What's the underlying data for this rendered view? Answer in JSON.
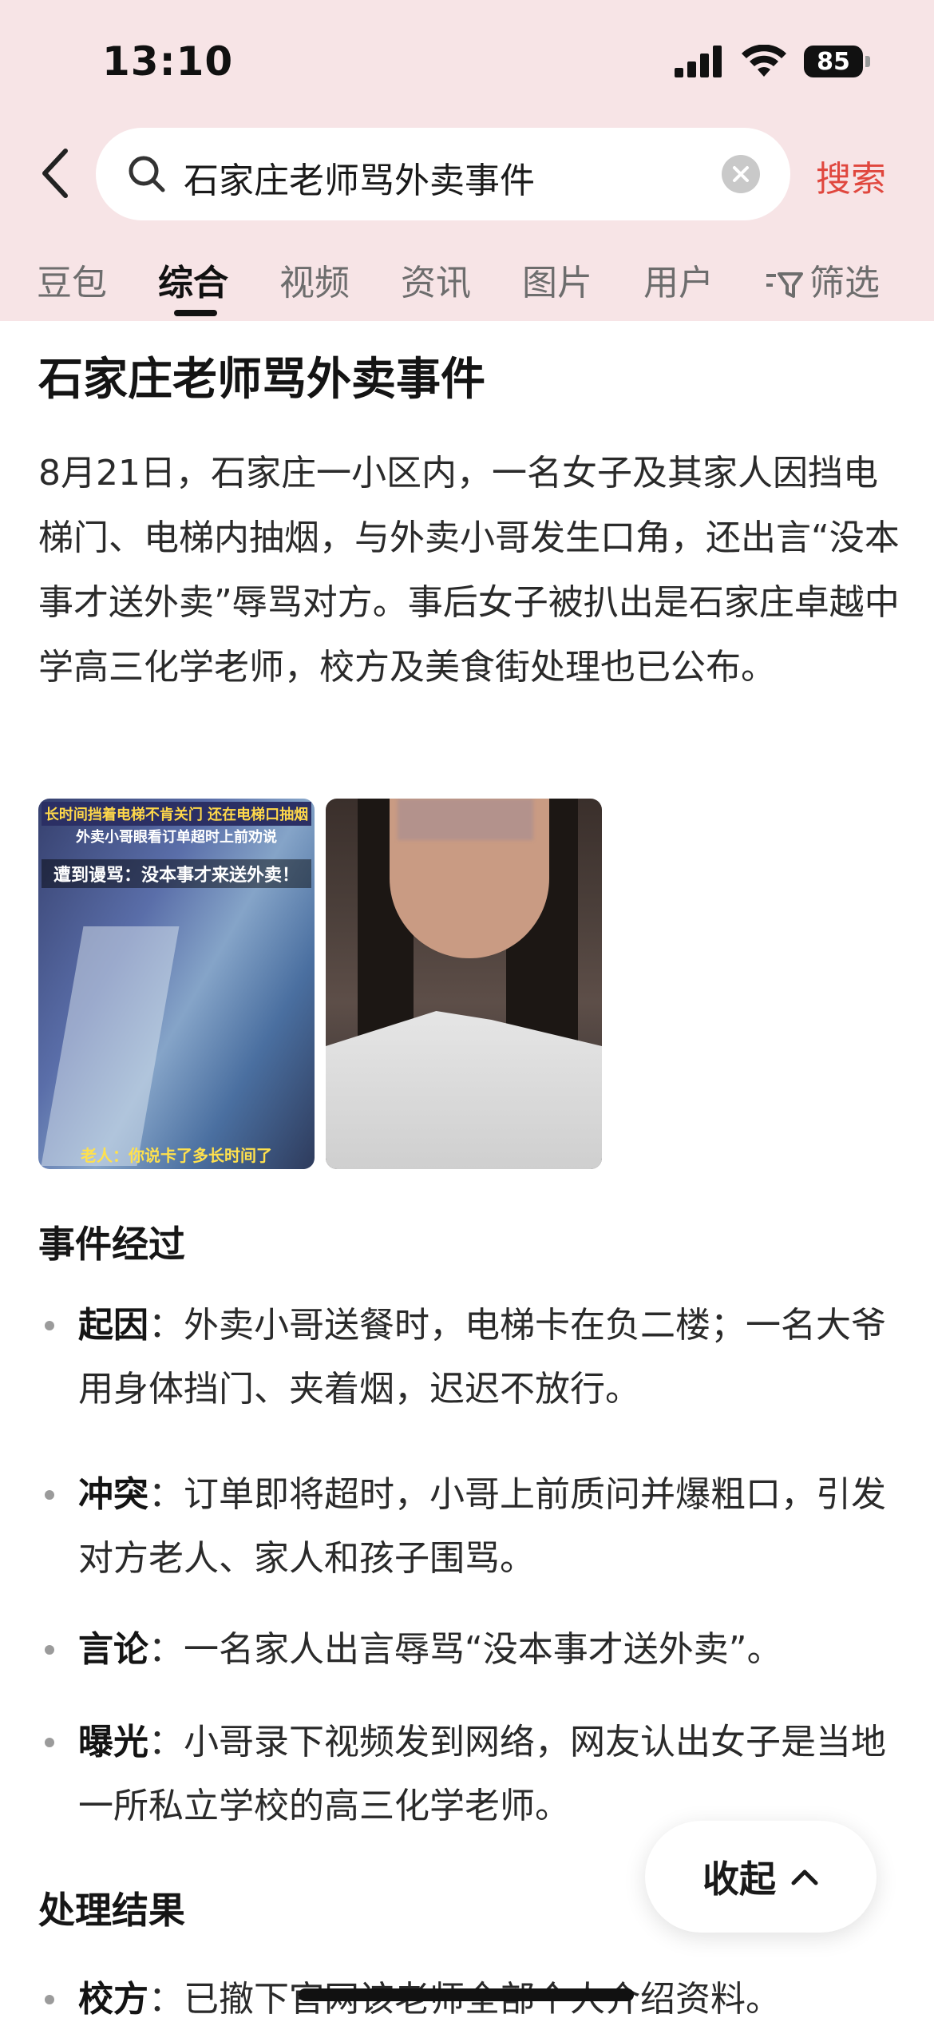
{
  "status_bar": {
    "time": "13:10",
    "battery": "85"
  },
  "search": {
    "query": "石家庄老师骂外卖事件",
    "button_label": "搜索"
  },
  "tabs": [
    {
      "label": "豆包"
    },
    {
      "label": "综合",
      "active": true
    },
    {
      "label": "视频"
    },
    {
      "label": "资讯"
    },
    {
      "label": "图片"
    },
    {
      "label": "用户"
    },
    {
      "label": "筛选"
    }
  ],
  "article": {
    "title": "石家庄老师骂外卖事件",
    "summary": "8月21日，石家庄一小区内，一名女子及其家人因挡电梯门、电梯内抽烟，与外卖小哥发生口角，还出言“没本事才送外卖”辱骂对方。事后女子被扒出是石家庄卓越中学高三化学老师，校方及美食街处理也已公布。",
    "images": [
      {
        "captions": [
          "长时间挡着电梯不肯关门 还在电梯口抽烟",
          "外卖小哥眼看订单超时上前劝说",
          "遭到谩骂：没本事才来送外卖！",
          "老人：你说卡了多长时间了"
        ]
      },
      {
        "captions": []
      }
    ],
    "section1_title": "事件经过",
    "events": [
      {
        "key": "起因",
        "text": "外卖小哥送餐时，电梯卡在负二楼；一名大爷用身体挡门、夹着烟，迟迟不放行。"
      },
      {
        "key": "冲突",
        "text": "订单即将超时，小哥上前质问并爆粗口，引发对方老人、家人和孩子围骂。"
      },
      {
        "key": "言论",
        "text": "一名家人出言辱骂“没本事才送外卖”。"
      },
      {
        "key": "曝光",
        "text": "小哥录下视频发到网络，网友认出女子是当地一所私立学校的高三化学老师。"
      }
    ],
    "section2_title": "处理结果",
    "results": [
      {
        "key": "校方",
        "text": "已撤下官网该老师全部个人介绍资料。"
      }
    ],
    "separator": "："
  },
  "collapse_label": "收起",
  "colors": {
    "header_bg": "#f7e4e6",
    "accent": "#e0473e"
  }
}
